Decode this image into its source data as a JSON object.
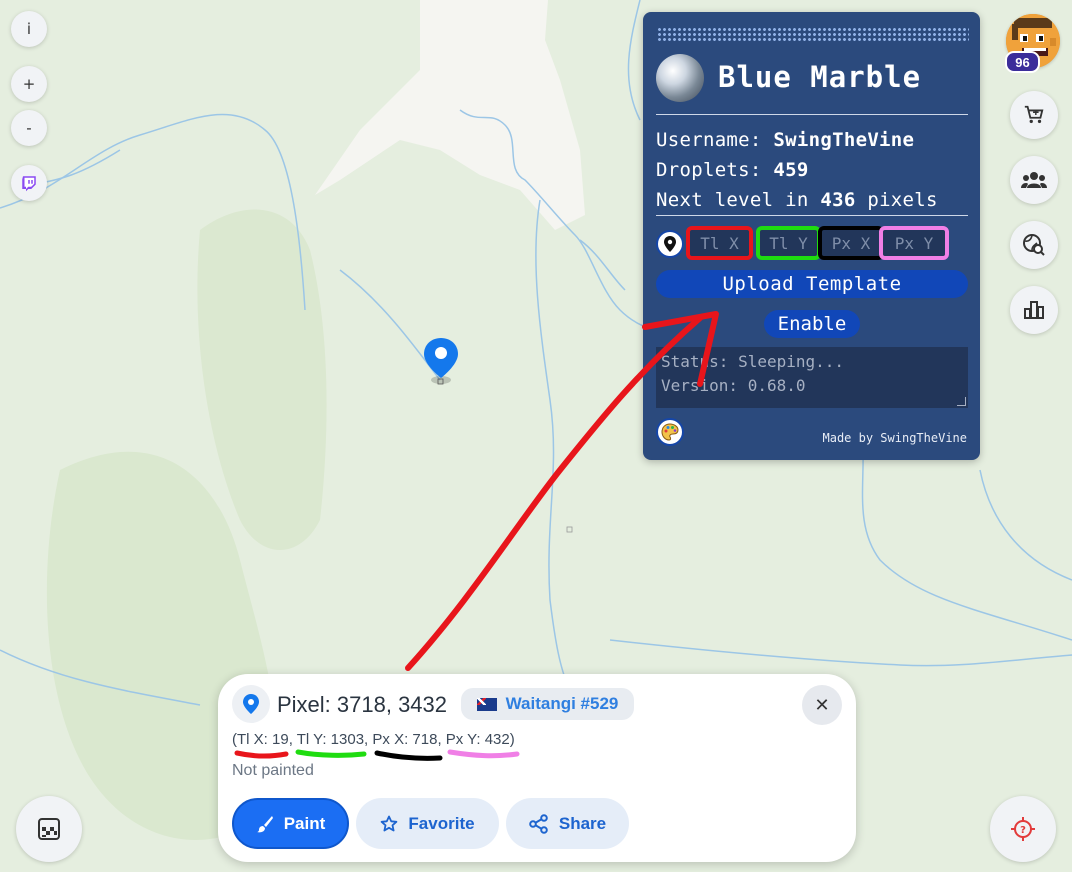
{
  "map": {
    "controls": {
      "info_label": "i",
      "zoom_in_label": "+",
      "zoom_out_label": "-"
    }
  },
  "blue_marble": {
    "title": "Blue Marble",
    "username_label": "Username:",
    "username": "SwingTheVine",
    "droplets_label": "Droplets:",
    "droplets": "459",
    "next_level_prefix": "Next level in",
    "next_level_value": "436",
    "next_level_suffix": "pixels",
    "coord_inputs": [
      {
        "placeholder": "Tl X",
        "highlight": "#e8151b"
      },
      {
        "placeholder": "Tl Y",
        "highlight": "#1fdc10"
      },
      {
        "placeholder": "Px X",
        "highlight": "#000000"
      },
      {
        "placeholder": "Px Y",
        "highlight": "#f07fe6"
      }
    ],
    "upload_label": "Upload Template",
    "enable_label": "Enable",
    "status_lines": [
      "Status: Sleeping...",
      "Version: 0.68.0"
    ],
    "made_by": "Made by SwingTheVine"
  },
  "user": {
    "level": "96"
  },
  "pixel_card": {
    "title": "Pixel: 3718, 3432",
    "region": "Waitangi #529",
    "coords": {
      "open": "(",
      "tl_x": "Tl X: 19",
      "tl_y": "Tl Y: 1303",
      "px_x": "Px X: 718",
      "px_y": "Px Y: 432",
      "sep": ", ",
      "close": ")"
    },
    "status": "Not painted",
    "paint_label": "Paint",
    "favorite_label": "Favorite",
    "share_label": "Share"
  },
  "colors": {
    "panel_bg": "#2b4a7d",
    "accent_blue": "#1b6ef3",
    "annotation_red": "#e8151b",
    "annotation_green": "#1fdc10",
    "annotation_black": "#000000",
    "annotation_pink": "#f07fe6"
  }
}
